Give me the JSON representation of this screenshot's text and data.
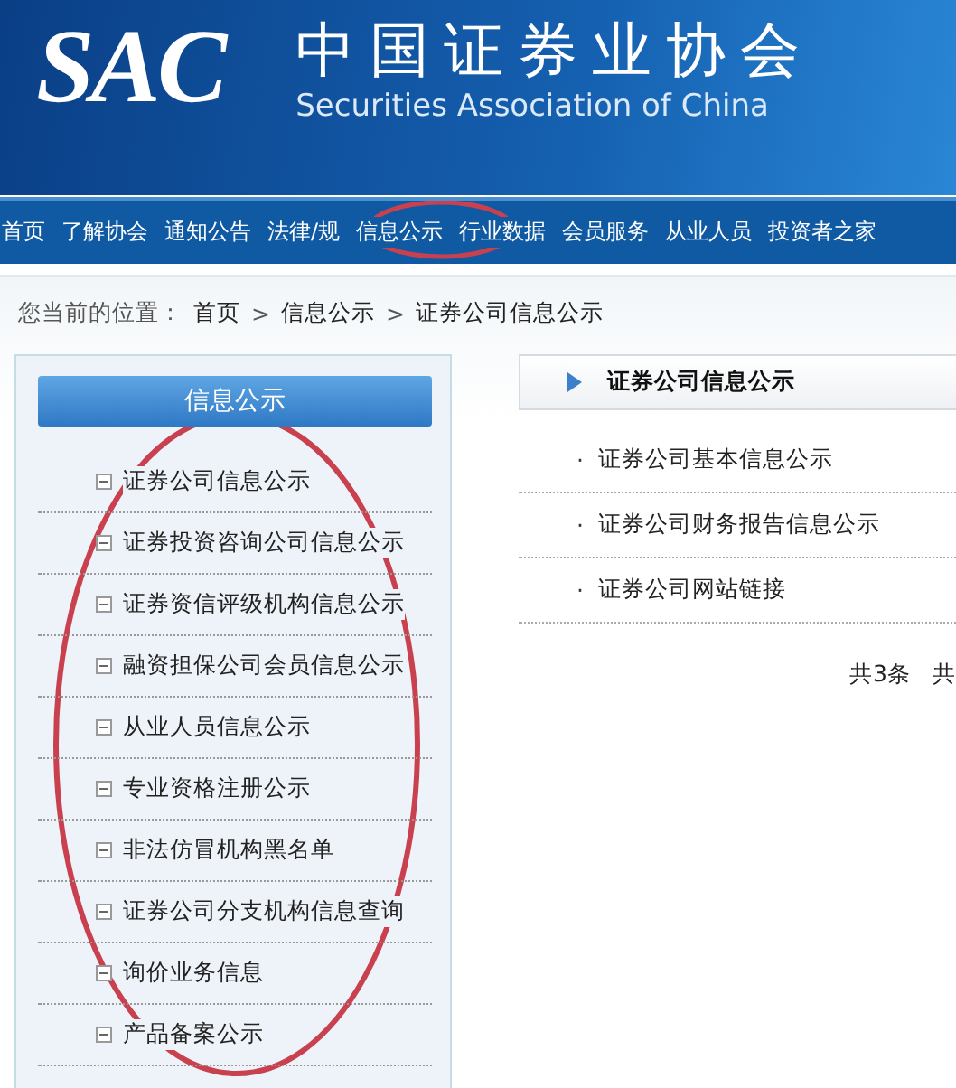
{
  "header": {
    "logo": "SAC",
    "title": "中国证券业协会",
    "subtitle": "Securities Association of China"
  },
  "nav": [
    "首页",
    "了解协会",
    "通知公告",
    "法律/规",
    "信息公示",
    "行业数据",
    "会员服务",
    "从业人员",
    "投资者之家"
  ],
  "breadcrumb": {
    "label": "您当前的位置：",
    "path": [
      "首页",
      "信息公示",
      "证券公司信息公示"
    ],
    "separator": ">"
  },
  "sidebar": {
    "title": "信息公示",
    "items": [
      "证券公司信息公示",
      "证券投资咨询公司信息公示",
      "证券资信评级机构信息公示",
      "融资担保公司会员信息公示",
      "从业人员信息公示",
      "专业资格注册公示",
      "非法仿冒机构黑名单",
      "证券公司分支机构信息查询",
      "询价业务信息",
      "产品备案公示"
    ]
  },
  "content": {
    "title": "证券公司信息公示",
    "bullet": "·",
    "items": [
      "证券公司基本信息公示",
      "证券公司财务报告信息公示",
      "证券公司网站链接"
    ],
    "pagination": [
      "共3条",
      "共"
    ]
  }
}
